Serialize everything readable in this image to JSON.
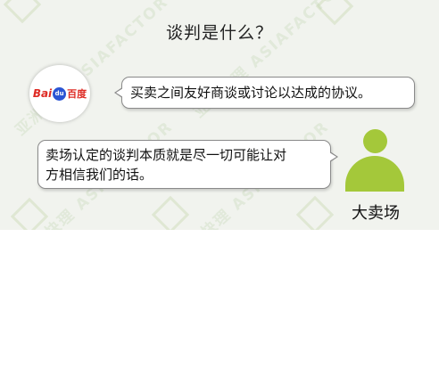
{
  "title": "谈判是什么？",
  "logo": {
    "latin": "Bai",
    "paw_text": "du",
    "chinese": "百度"
  },
  "bubble_left": {
    "text": "买卖之间友好商谈或讨论以达成的协议。"
  },
  "bubble_right": {
    "line1": "卖场认定的谈判本质就是尽一切可能让对",
    "line2": "方相信我们的话。"
  },
  "person": {
    "label": "大卖场"
  },
  "watermark": {
    "text": "亚洲快理 ASIAFACTOR"
  },
  "colors": {
    "panel_bg": "#f1f3ee",
    "person_green": "#a4c83a",
    "baidu_red": "#de2b24",
    "baidu_blue": "#2a55d4"
  },
  "icons": {
    "logo": "baidu-logo-icon",
    "person": "person-silhouette-icon"
  }
}
